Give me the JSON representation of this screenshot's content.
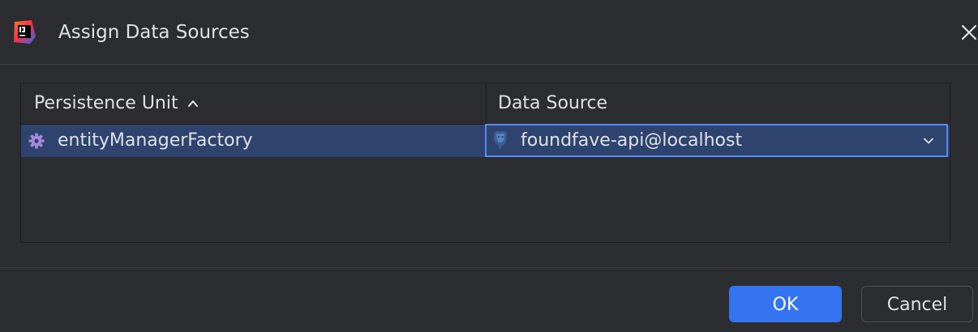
{
  "dialog": {
    "title": "Assign Data Sources",
    "app_icon": "intellij-idea-icon",
    "close_icon": "close-icon"
  },
  "table": {
    "columns": [
      {
        "label": "Persistence Unit",
        "sort": "ascending",
        "sort_icon": "sort-ascending-icon"
      },
      {
        "label": "Data Source"
      }
    ],
    "rows": [
      {
        "persistence_unit": "entityManagerFactory",
        "unit_icon": "gear-icon",
        "data_source": "foundfave-api@localhost",
        "data_source_icon": "postgresql-icon",
        "selected": true
      }
    ]
  },
  "buttons": {
    "ok_label": "OK",
    "cancel_label": "Cancel"
  },
  "colors": {
    "background": "#2b2d30",
    "selection": "#2e436e",
    "focus_border": "#548af7",
    "primary_button": "#3574f0",
    "gear_icon": "#a688d8"
  }
}
